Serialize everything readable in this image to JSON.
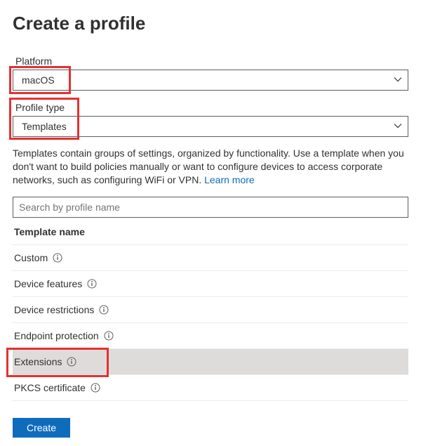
{
  "page": {
    "title": "Create a profile"
  },
  "platform": {
    "label": "Platform",
    "value": "macOS"
  },
  "profile_type": {
    "label": "Profile type",
    "value": "Templates"
  },
  "description": {
    "text": "Templates contain groups of settings, organized by functionality. Use a template when you don't want to build policies manually or want to configure devices to access corporate networks, such as configuring WiFi or VPN. ",
    "learn_more": "Learn more"
  },
  "search": {
    "placeholder": "Search by profile name"
  },
  "table": {
    "header": "Template name",
    "rows": [
      {
        "name": "Custom",
        "selected": false
      },
      {
        "name": "Device features",
        "selected": false
      },
      {
        "name": "Device restrictions",
        "selected": false
      },
      {
        "name": "Endpoint protection",
        "selected": false
      },
      {
        "name": "Extensions",
        "selected": true
      },
      {
        "name": "PKCS certificate",
        "selected": false
      }
    ]
  },
  "buttons": {
    "create": "Create"
  },
  "icons": {
    "chevron_down": "chevron-down",
    "info": "info"
  }
}
